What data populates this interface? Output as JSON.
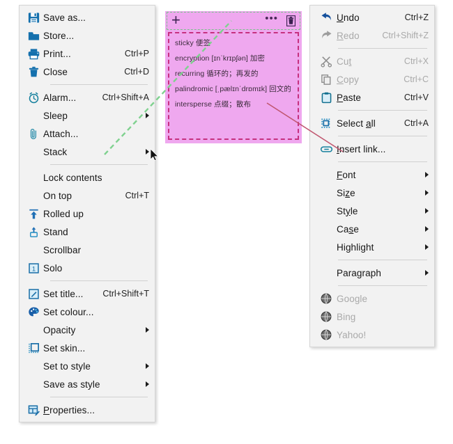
{
  "left_menu": {
    "name": "note-context-menu",
    "items": [
      {
        "icon": "save-icon",
        "label": "Save as...",
        "accel": "",
        "submenu": false,
        "disabled": false
      },
      {
        "icon": "folder-icon",
        "label": "Store...",
        "accel": "",
        "submenu": false,
        "disabled": false
      },
      {
        "icon": "printer-icon",
        "label": "Print...",
        "accel": "Ctrl+P",
        "submenu": false,
        "disabled": false
      },
      {
        "icon": "trash-icon",
        "label": "Close",
        "accel": "Ctrl+D",
        "submenu": false,
        "disabled": false
      },
      {
        "icon": "separator",
        "label": "",
        "accel": "",
        "submenu": false,
        "disabled": false
      },
      {
        "icon": "alarm-icon",
        "label": "Alarm...",
        "accel": "Ctrl+Shift+A",
        "submenu": false,
        "disabled": false
      },
      {
        "icon": "none",
        "label": "Sleep",
        "accel": "",
        "submenu": true,
        "disabled": false
      },
      {
        "icon": "paperclip-icon",
        "label": "Attach...",
        "accel": "",
        "submenu": false,
        "disabled": false
      },
      {
        "icon": "none",
        "label": "Stack",
        "accel": "",
        "submenu": true,
        "disabled": false
      },
      {
        "icon": "separator",
        "label": "",
        "accel": "",
        "submenu": false,
        "disabled": false
      },
      {
        "icon": "none",
        "label": "Lock contents",
        "accel": "",
        "submenu": false,
        "disabled": false
      },
      {
        "icon": "none",
        "label": "On top",
        "accel": "Ctrl+T",
        "submenu": false,
        "disabled": false
      },
      {
        "icon": "roll-up-icon",
        "label": "Rolled up",
        "accel": "",
        "submenu": false,
        "disabled": false
      },
      {
        "icon": "stand-icon",
        "label": "Stand",
        "accel": "",
        "submenu": false,
        "disabled": false
      },
      {
        "icon": "none",
        "label": "Scrollbar",
        "accel": "",
        "submenu": false,
        "disabled": false
      },
      {
        "icon": "solo-icon",
        "label": "Solo",
        "accel": "",
        "submenu": false,
        "disabled": false
      },
      {
        "icon": "separator",
        "label": "",
        "accel": "",
        "submenu": false,
        "disabled": false
      },
      {
        "icon": "pencil-icon",
        "label": "Set title...",
        "accel": "Ctrl+Shift+T",
        "submenu": false,
        "disabled": false
      },
      {
        "icon": "palette-icon",
        "label": "Set colour...",
        "accel": "",
        "submenu": false,
        "disabled": false
      },
      {
        "icon": "none",
        "label": "Opacity",
        "accel": "",
        "submenu": true,
        "disabled": false
      },
      {
        "icon": "skin-icon",
        "label": "Set skin...",
        "accel": "",
        "submenu": false,
        "disabled": false
      },
      {
        "icon": "none",
        "label": "Set to style",
        "accel": "",
        "submenu": true,
        "disabled": false
      },
      {
        "icon": "none",
        "label": "Save as style",
        "accel": "",
        "submenu": true,
        "disabled": false
      },
      {
        "icon": "separator",
        "label": "",
        "accel": "",
        "submenu": false,
        "disabled": false
      },
      {
        "icon": "properties-icon",
        "label": "Properties...",
        "accel": "",
        "submenu": false,
        "disabled": false,
        "underline_first": true
      }
    ]
  },
  "right_menu": {
    "name": "text-context-menu",
    "items": [
      {
        "icon": "undo-icon",
        "label": "Undo",
        "accel": "Ctrl+Z",
        "submenu": false,
        "disabled": false,
        "mnemonic": 0
      },
      {
        "icon": "redo-icon",
        "label": "Redo",
        "accel": "Ctrl+Shift+Z",
        "submenu": false,
        "disabled": true,
        "mnemonic": 0
      },
      {
        "icon": "separator",
        "label": "",
        "accel": "",
        "submenu": false,
        "disabled": false
      },
      {
        "icon": "scissors-icon",
        "label": "Cut",
        "accel": "Ctrl+X",
        "submenu": false,
        "disabled": true,
        "mnemonic": 2
      },
      {
        "icon": "copy-icon",
        "label": "Copy",
        "accel": "Ctrl+C",
        "submenu": false,
        "disabled": true,
        "mnemonic": 0
      },
      {
        "icon": "clipboard-icon",
        "label": "Paste",
        "accel": "Ctrl+V",
        "submenu": false,
        "disabled": false,
        "mnemonic": 0
      },
      {
        "icon": "separator",
        "label": "",
        "accel": "",
        "submenu": false,
        "disabled": false
      },
      {
        "icon": "selectall-icon",
        "label": "Select all",
        "accel": "Ctrl+A",
        "submenu": false,
        "disabled": false,
        "mnemonic": 7
      },
      {
        "icon": "separator",
        "label": "",
        "accel": "",
        "submenu": false,
        "disabled": false
      },
      {
        "icon": "link-icon",
        "label": "Insert link...",
        "accel": "",
        "submenu": false,
        "disabled": false,
        "mnemonic": 0
      },
      {
        "icon": "separator",
        "label": "",
        "accel": "",
        "submenu": false,
        "disabled": false
      },
      {
        "icon": "none",
        "label": "Font",
        "accel": "",
        "submenu": true,
        "disabled": false,
        "mnemonic": 0
      },
      {
        "icon": "none",
        "label": "Size",
        "accel": "",
        "submenu": true,
        "disabled": false,
        "mnemonic": 2
      },
      {
        "icon": "none",
        "label": "Style",
        "accel": "",
        "submenu": true,
        "disabled": false,
        "mnemonic": 2
      },
      {
        "icon": "none",
        "label": "Case",
        "accel": "",
        "submenu": true,
        "disabled": false,
        "mnemonic": 2
      },
      {
        "icon": "none",
        "label": "Highlight",
        "accel": "",
        "submenu": true,
        "disabled": false
      },
      {
        "icon": "separator",
        "label": "",
        "accel": "",
        "submenu": false,
        "disabled": false
      },
      {
        "icon": "none",
        "label": "Paragraph",
        "accel": "",
        "submenu": true,
        "disabled": false,
        "mnemonic": 4
      },
      {
        "icon": "separator",
        "label": "",
        "accel": "",
        "submenu": false,
        "disabled": false
      },
      {
        "icon": "globe-icon",
        "label": "Google",
        "accel": "",
        "submenu": false,
        "disabled": true
      },
      {
        "icon": "globe-icon",
        "label": "Bing",
        "accel": "",
        "submenu": false,
        "disabled": true
      },
      {
        "icon": "globe-icon",
        "label": "Yahoo!",
        "accel": "",
        "submenu": false,
        "disabled": true
      }
    ]
  },
  "note": {
    "name": "sticky-note",
    "background_color": "#efa8ef",
    "titlebar_border_color": "#79c28a",
    "body_border_color": "#c6307f",
    "toolbar": {
      "add_label": "+",
      "menu_label": "•••",
      "delete_label": "delete"
    },
    "lines": [
      "sticky 便签",
      "encryption [ɪnˈkrɪpʃən] 加密",
      "recurring 循环的；再发的",
      "palindromic [ˌpælɪnˈdrɒmɪk] 回文的",
      "intersperse 点缀；散布"
    ]
  },
  "annotations": {
    "green_line_color": "#7fd18f",
    "red_line_color": "#c0566f"
  }
}
